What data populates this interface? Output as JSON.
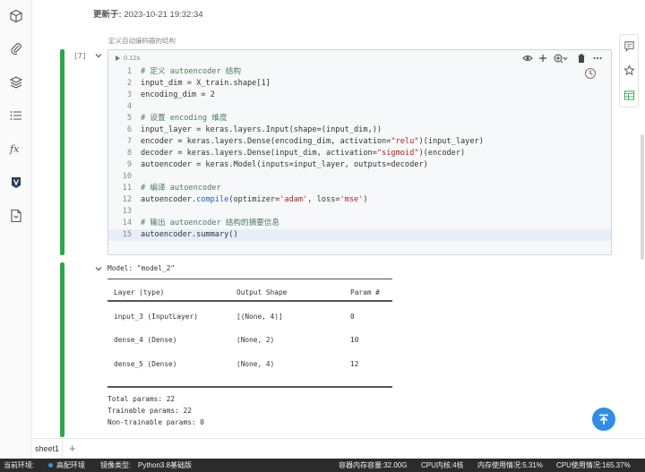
{
  "header": {
    "updated_label": "更新于:",
    "updated_time": "2023-10-21 19:32:34",
    "markdown_title": "定义自动编码器的结构"
  },
  "left_rail": {
    "icons": [
      "cube-icon",
      "paperclip-icon",
      "layers-icon",
      "list-icon",
      "function-icon",
      "variable-icon",
      "file-icon"
    ],
    "function_glyph": "fx"
  },
  "right_rail": {
    "icons": [
      "comment-icon",
      "star-icon",
      "table-icon"
    ]
  },
  "cell": {
    "execution_count": "[7]",
    "run_time": "0.12s",
    "toolbar_icons": [
      "eye-icon",
      "plus-icon",
      "move-icon",
      "trash-icon",
      "more-icon"
    ],
    "code_lines": [
      {
        "n": "1",
        "tokens": [
          {
            "t": "# 定义 autoencoder 结构",
            "c": "cm"
          }
        ]
      },
      {
        "n": "2",
        "tokens": [
          {
            "t": "input_dim = X_train.shape[1]",
            "c": ""
          }
        ]
      },
      {
        "n": "3",
        "tokens": [
          {
            "t": "encoding_dim = 2",
            "c": ""
          }
        ]
      },
      {
        "n": "4",
        "tokens": []
      },
      {
        "n": "5",
        "tokens": [
          {
            "t": "# 设置 encoding 维度",
            "c": "cm"
          }
        ]
      },
      {
        "n": "6",
        "tokens": [
          {
            "t": "input_layer = keras.layers.Input(shape=(input_dim,))",
            "c": ""
          }
        ]
      },
      {
        "n": "7",
        "tokens": [
          {
            "t": "encoder = keras.layers.Dense(encoding_dim, activation=",
            "c": ""
          },
          {
            "t": "\"relu\"",
            "c": "st"
          },
          {
            "t": ")(input_layer)",
            "c": ""
          }
        ]
      },
      {
        "n": "8",
        "tokens": [
          {
            "t": "decoder = keras.layers.Dense(input_dim, activation=",
            "c": ""
          },
          {
            "t": "\"sigmoid\"",
            "c": "st"
          },
          {
            "t": ")(encoder)",
            "c": ""
          }
        ]
      },
      {
        "n": "9",
        "tokens": [
          {
            "t": "autoencoder = keras.Model(inputs=input_layer, outputs=decoder)",
            "c": ""
          }
        ]
      },
      {
        "n": "10",
        "tokens": []
      },
      {
        "n": "11",
        "tokens": [
          {
            "t": "# 编译 autoencoder",
            "c": "cm"
          }
        ]
      },
      {
        "n": "12",
        "tokens": [
          {
            "t": "autoencoder.",
            "c": ""
          },
          {
            "t": "compile",
            "c": "nm"
          },
          {
            "t": "(optimizer=",
            "c": ""
          },
          {
            "t": "'adam'",
            "c": "st"
          },
          {
            "t": ", loss=",
            "c": ""
          },
          {
            "t": "'mse'",
            "c": "st"
          },
          {
            "t": ")",
            "c": ""
          }
        ]
      },
      {
        "n": "13",
        "tokens": []
      },
      {
        "n": "14",
        "tokens": [
          {
            "t": "# 输出 autoencoder 结构的摘要信息",
            "c": "cm"
          }
        ]
      },
      {
        "n": "15",
        "tokens": [
          {
            "t": "autoencoder.summary()",
            "c": ""
          }
        ]
      }
    ],
    "active_line": "15"
  },
  "output": {
    "model_line": "Model: \"model_2\"",
    "headers": [
      "Layer (type)",
      "Output Shape",
      "Param #"
    ],
    "rows": [
      {
        "layer": "input_3 (InputLayer)",
        "shape": "[(None, 4)]",
        "params": "0"
      },
      {
        "layer": "dense_4 (Dense)",
        "shape": "(None, 2)",
        "params": "10"
      },
      {
        "layer": "dense_5 (Dense)",
        "shape": "(None, 4)",
        "params": "12"
      }
    ],
    "total_params": "Total params: 22",
    "trainable_params": "Trainable params: 22",
    "non_trainable_params": "Non-trainable params: 0"
  },
  "sheets": {
    "tabs": [
      "sheet1"
    ],
    "add_label": "+"
  },
  "status_bar": {
    "env_label": "当前环境:",
    "env_value": "高配环境",
    "image_label": "镜像类型:",
    "image_value": "Python3.8基础版",
    "memory": "容器内存容量:32.00G",
    "cpu_cores": "CPU内核:4核",
    "memory_usage": "内存使用情况:5.31%",
    "cpu_usage": "CPU使用情况:165.37%"
  },
  "colors": {
    "accent_green": "#2ca74b",
    "accent_blue": "#2f8de4",
    "status_bg": "#2b2b2b"
  }
}
